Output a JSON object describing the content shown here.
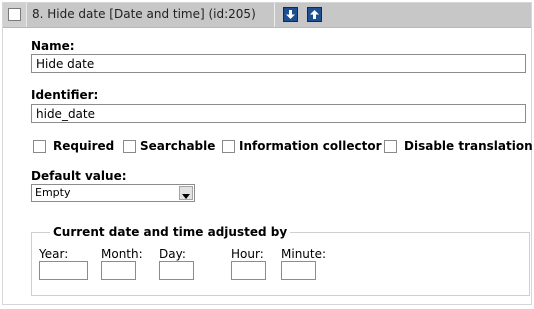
{
  "header": {
    "title": "8. Hide date [Date and time] (id:205)",
    "move_down_icon": "arrow-down-icon",
    "move_up_icon": "arrow-up-icon"
  },
  "name": {
    "label": "Name:",
    "value": "Hide date"
  },
  "identifier": {
    "label": "Identifier:",
    "value": "hide_date"
  },
  "options": [
    {
      "label": "Required",
      "checked": false
    },
    {
      "label": "Searchable",
      "checked": false
    },
    {
      "label": "Information collector",
      "checked": false
    },
    {
      "label": "Disable translation",
      "checked": false
    }
  ],
  "default_value": {
    "label": "Default value:",
    "selected": "Empty"
  },
  "adjust": {
    "legend": "Current date and time adjusted by",
    "year": "Year:",
    "month": "Month:",
    "day": "Day:",
    "hour": "Hour:",
    "minute": "Minute:"
  },
  "colors": {
    "header_bg": "#c7c7c7",
    "arrow_button": "#1d4f91"
  }
}
